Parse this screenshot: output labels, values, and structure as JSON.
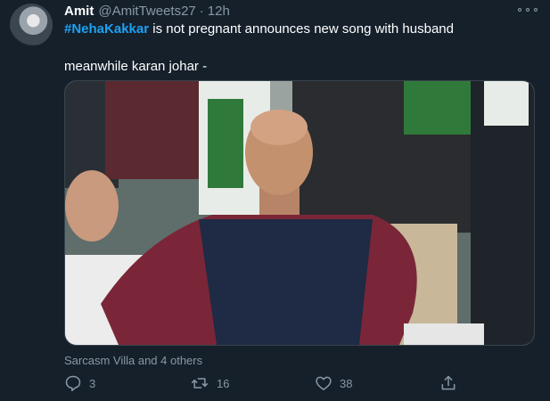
{
  "tweet": {
    "author_name": "Amit",
    "author_handle": "@AmitTweets27",
    "separator": "·",
    "timestamp": "12h",
    "hashtag": "#NehaKakkar",
    "text_line1": " is not pregnant announces new song with husband",
    "text_line2": "meanwhile karan johar -",
    "liked_by": "Sarcasm Villa and 4 others",
    "reply_count": "3",
    "retweet_count": "16",
    "like_count": "38"
  },
  "icons": {
    "more": "more-dots-icon",
    "reply": "reply-icon",
    "retweet": "retweet-icon",
    "like": "heart-icon",
    "share": "share-icon"
  },
  "colors": {
    "background": "#15202b",
    "hashtag": "#1da1f2",
    "secondary_text": "#8899a6"
  }
}
